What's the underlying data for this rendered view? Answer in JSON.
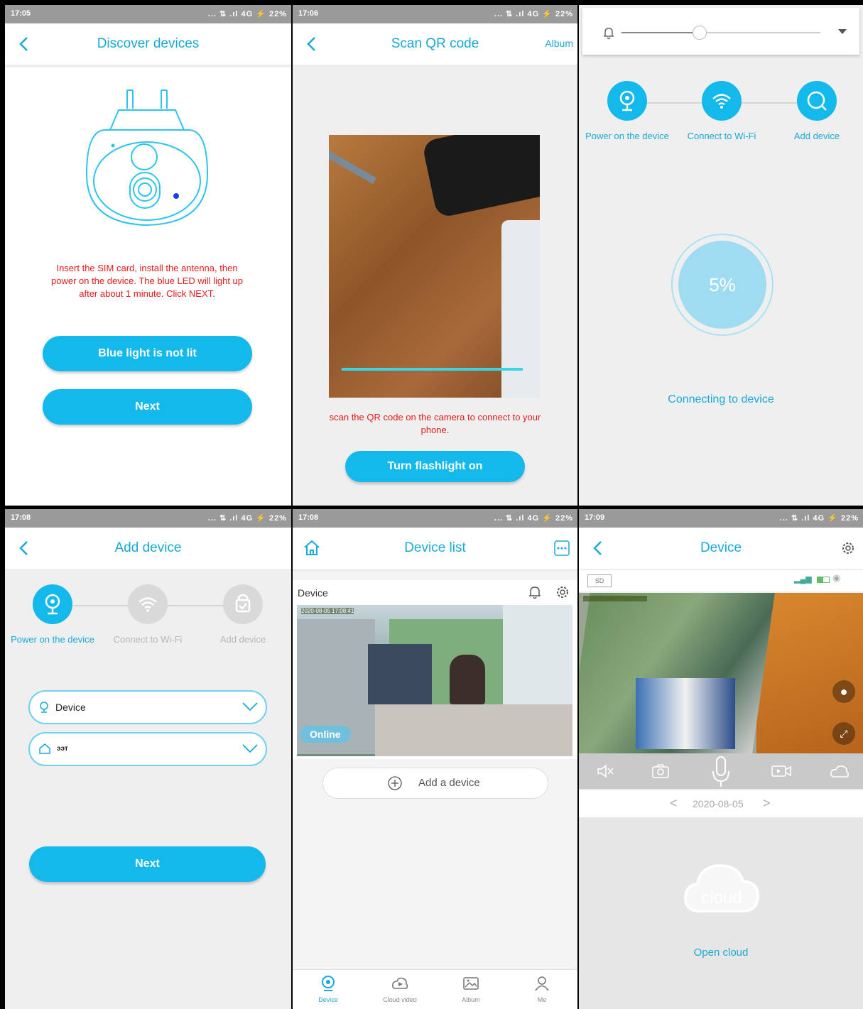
{
  "status_times": [
    "17:05",
    "17:06",
    "17:08",
    "17:08",
    "17:09"
  ],
  "status_indicators": "... ⇅ .ıl 4G ⚡ 22%",
  "colors": {
    "accent": "#14b9ec",
    "accent_text": "#1aa9d8",
    "warning": "#e51a1a"
  },
  "discover": {
    "title": "Discover devices",
    "instruction": "Insert the SIM card, install the antenna, then power on the device. The blue LED will light up after about 1 minute. Click NEXT.",
    "btn_blue": "Blue light is not lit",
    "btn_next": "Next"
  },
  "scan": {
    "title": "Scan QR code",
    "album": "Album",
    "instruction": "scan the QR code on the camera to connect to your phone.",
    "btn_flash": "Turn flashlight on"
  },
  "progress": {
    "steps": [
      "Power on the device",
      "Connect to Wi-Fi",
      "Add device"
    ],
    "percent": "5%",
    "status": "Connecting to device",
    "volume_level": 0.39
  },
  "add_device": {
    "title": "Add device",
    "steps": [
      "Power on the device",
      "Connect to Wi-Fi",
      "Add device"
    ],
    "device_field": "Device",
    "room_field": "ээт",
    "btn_next": "Next"
  },
  "device_list": {
    "title": "Device list",
    "card_title": "Device",
    "timestamp": "2020-08-05  17:08:41",
    "online": "Online",
    "add": "Add a device",
    "tabs": [
      "Device",
      "Cloud video",
      "Album",
      "Me"
    ]
  },
  "device_view": {
    "title": "Device",
    "sd": "SD",
    "date": "2020-08-05",
    "cloud": "cloud",
    "open_cloud": "Open cloud"
  }
}
